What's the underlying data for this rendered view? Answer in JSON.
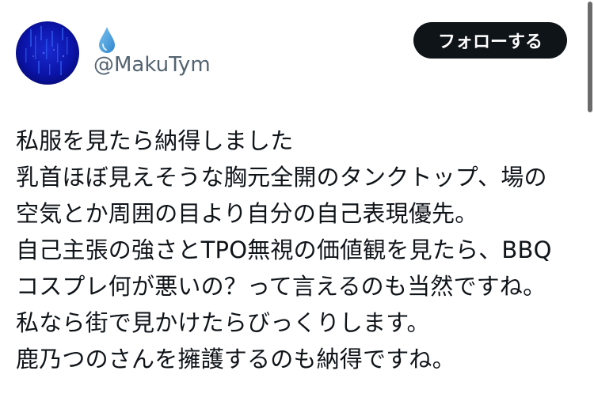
{
  "user": {
    "display_name_icon": "droplet-emoji",
    "handle": "@MakuTym"
  },
  "follow_button": {
    "label": "フォローする"
  },
  "tweet": {
    "lines": [
      "私服を見たら納得しました",
      "乳首ほぼ見えそうな胸元全開のタンクトップ、場の",
      "空気とか周囲の目より自分の自己表現優先。",
      "自己主張の強さとTPO無視の価値観を見たら、BBQ",
      "コスプレ何が悪いの？って言えるのも当然ですね。",
      "私なら街で見かけたらびっくりします。",
      "鹿乃つのさんを擁護するのも納得ですね。"
    ]
  },
  "colors": {
    "text": "#0f1419",
    "secondary_text": "#536471",
    "button_bg": "#0f1419",
    "button_text": "#ffffff",
    "avatar_bg": "#0a0f8a",
    "droplet": "#4aa3df"
  }
}
